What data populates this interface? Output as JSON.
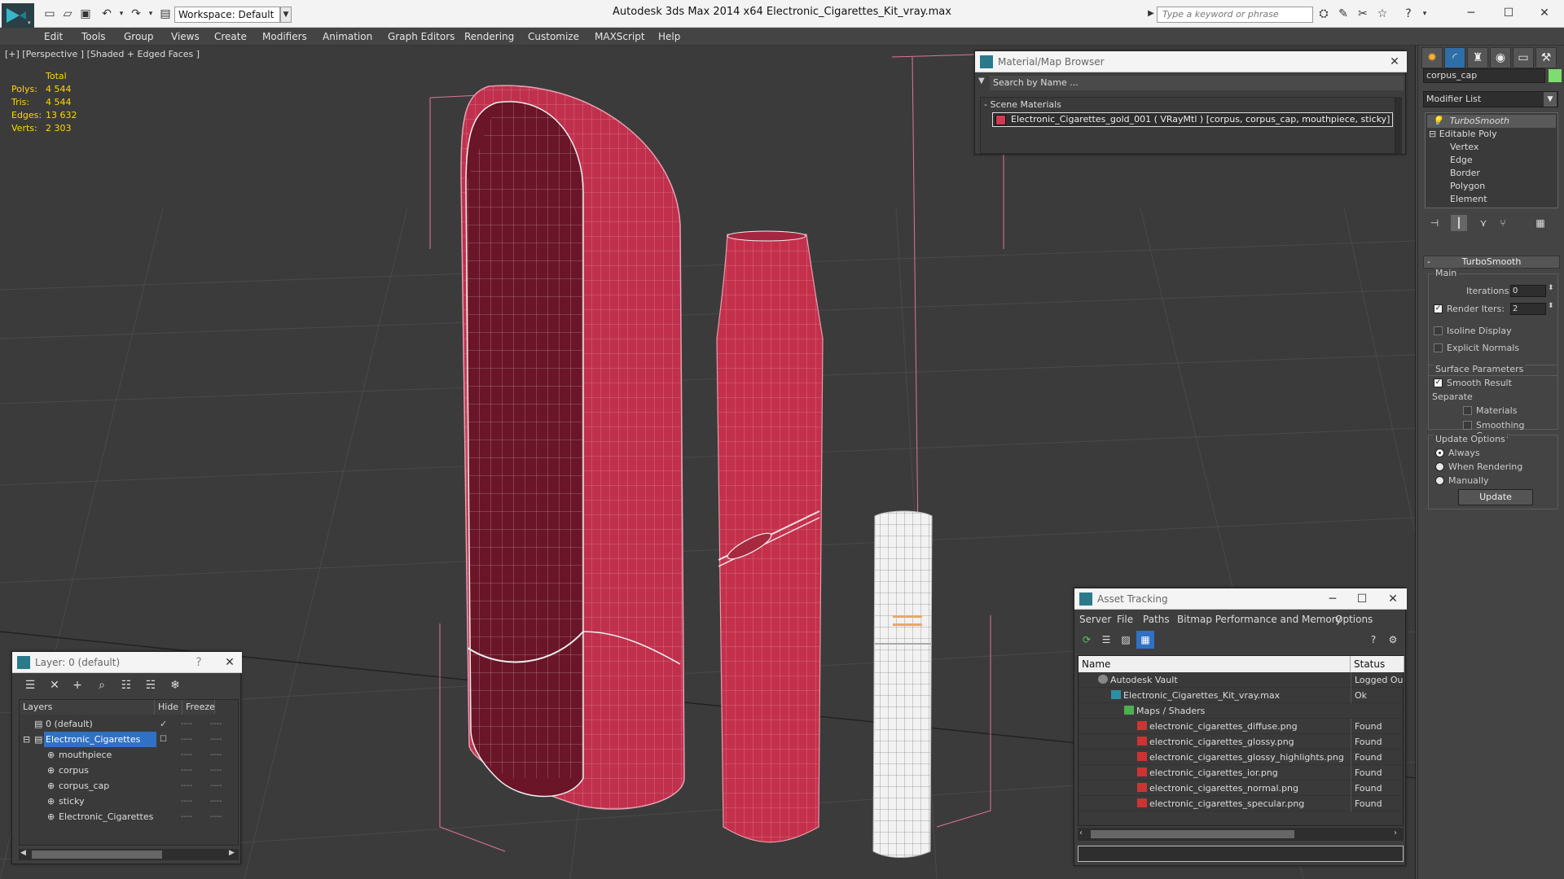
{
  "titlebar": {
    "app_title": "Autodesk 3ds Max  2014 x64     Electronic_Cigarettes_Kit_vray.max",
    "workspace": "Workspace: Default",
    "search_placeholder": "Type a keyword or phrase"
  },
  "menu": [
    "Edit",
    "Tools",
    "Group",
    "Views",
    "Create",
    "Modifiers",
    "Animation",
    "Graph Editors",
    "Rendering",
    "Customize",
    "MAXScript",
    "Help"
  ],
  "viewport": {
    "label": "[+] [Perspective ] [Shaded + Edged Faces ]",
    "stats": {
      "header": "Total",
      "polys_label": "Polys:",
      "polys": "4 544",
      "tris_label": "Tris:",
      "tris": "4 544",
      "edges_label": "Edges:",
      "edges": "13 632",
      "verts_label": "Verts:",
      "verts": "2 303"
    }
  },
  "command_panel": {
    "object_name": "corpus_cap",
    "object_color": "#7fdc6f",
    "modifier_list": "Modifier List",
    "stack": {
      "turbosmooth": "TurboSmooth",
      "editable_poly": "Editable Poly",
      "sub": [
        "Vertex",
        "Edge",
        "Border",
        "Polygon",
        "Element"
      ]
    },
    "turbosmooth": {
      "title": "TurboSmooth",
      "main": "Main",
      "iterations_label": "Iterations:",
      "iterations": "0",
      "render_iters_label": "Render Iters:",
      "render_iters": "2",
      "isoline": "Isoline Display",
      "explicit_normals": "Explicit Normals",
      "surface_params": "Surface Parameters",
      "smooth_result": "Smooth Result",
      "separate": "Separate",
      "materials": "Materials",
      "smoothing_groups": "Smoothing Groups",
      "update_options": "Update Options",
      "always": "Always",
      "when_rendering": "When Rendering",
      "manually": "Manually",
      "update_button": "Update"
    }
  },
  "material_browser": {
    "title": "Material/Map Browser",
    "search": "Search by Name ...",
    "section": "- Scene Materials",
    "item": "Electronic_Cigarettes_gold_001  ( VRayMtl ) [corpus, corpus_cap, mouthpiece, sticky]",
    "swatch_color": "#d03a52"
  },
  "layer_panel": {
    "title": "Layer: 0 (default)",
    "help": "?",
    "col_layers": "Layers",
    "col_hide": "Hide",
    "col_freeze": "Freeze",
    "rows": [
      "0 (default)",
      "Electronic_Cigarettes",
      "mouthpiece",
      "corpus",
      "corpus_cap",
      "sticky",
      "Electronic_Cigarettes"
    ],
    "dots": "----"
  },
  "asset_tracking": {
    "title": "Asset Tracking",
    "menu": [
      "Server",
      "File",
      "Paths",
      "Bitmap Performance and Memory",
      "Options"
    ],
    "col_name": "Name",
    "col_status": "Status",
    "rows": [
      {
        "name": "Autodesk Vault",
        "status": "Logged Ou"
      },
      {
        "name": "Electronic_Cigarettes_Kit_vray.max",
        "status": "Ok"
      },
      {
        "name": "Maps / Shaders",
        "status": ""
      },
      {
        "name": "electronic_cigarettes_diffuse.png",
        "status": "Found"
      },
      {
        "name": "electronic_cigarettes_glossy.png",
        "status": "Found"
      },
      {
        "name": "electronic_cigarettes_glossy_highlights.png",
        "status": "Found"
      },
      {
        "name": "electronic_cigarettes_ior.png",
        "status": "Found"
      },
      {
        "name": "electronic_cigarettes_normal.png",
        "status": "Found"
      },
      {
        "name": "electronic_cigarettes_specular.png",
        "status": "Found"
      }
    ]
  }
}
